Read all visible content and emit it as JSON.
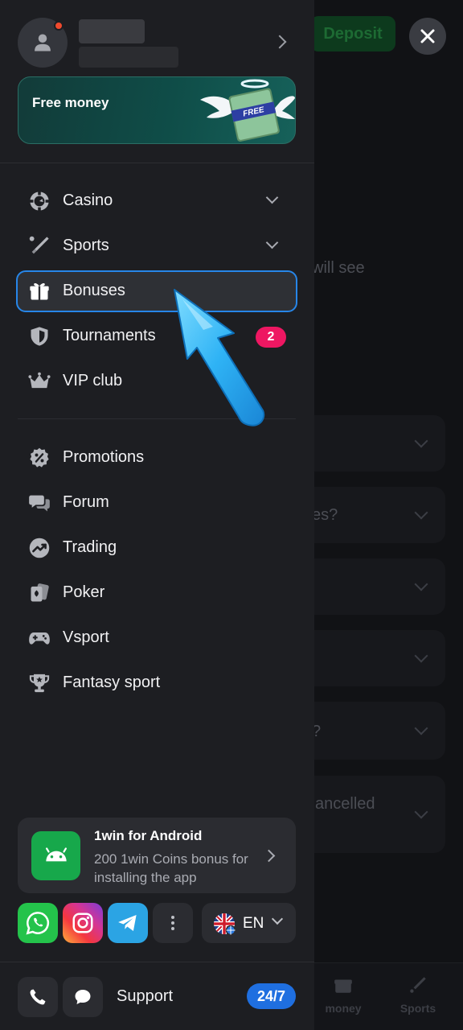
{
  "background": {
    "deposit_label": "Deposit",
    "texts": [
      "will see",
      "es?",
      "?",
      "ancelled"
    ],
    "tabs": [
      "money",
      "Sports"
    ]
  },
  "profile": {},
  "promo": {
    "label": "Free money",
    "art_tag": "FREE"
  },
  "nav": {
    "main": [
      {
        "label": "Casino",
        "icon": "casino-chip-icon",
        "expandable": true
      },
      {
        "label": "Sports",
        "icon": "sports-bat-icon",
        "expandable": true
      },
      {
        "label": "Bonuses",
        "icon": "gift-icon",
        "active": true
      },
      {
        "label": "Tournaments",
        "icon": "shield-icon",
        "badge": "2"
      },
      {
        "label": "VIP club",
        "icon": "crown-icon"
      }
    ],
    "secondary": [
      {
        "label": "Promotions",
        "icon": "percent-badge-icon"
      },
      {
        "label": "Forum",
        "icon": "chat-bubbles-icon"
      },
      {
        "label": "Trading",
        "icon": "trend-chart-icon"
      },
      {
        "label": "Poker",
        "icon": "playing-cards-icon"
      },
      {
        "label": "Vsport",
        "icon": "gamepad-icon"
      },
      {
        "label": "Fantasy sport",
        "icon": "trophy-icon"
      }
    ]
  },
  "app_promo": {
    "title": "1win for Android",
    "subtitle": "200 1win Coins bonus for installing the app",
    "icon": "android-icon"
  },
  "socials": [
    "whatsapp-icon",
    "instagram-icon",
    "telegram-icon",
    "more-dots-icon"
  ],
  "language": {
    "code": "EN",
    "flag": "uk-flag-icon"
  },
  "support": {
    "label": "Support",
    "badge": "24/7"
  },
  "colors": {
    "drawer_bg": "#1d1e22",
    "active_border": "#2786e8",
    "badge_pink": "#ee1762",
    "support_blue": "#1f6fe0",
    "android_green": "#17a84b"
  }
}
